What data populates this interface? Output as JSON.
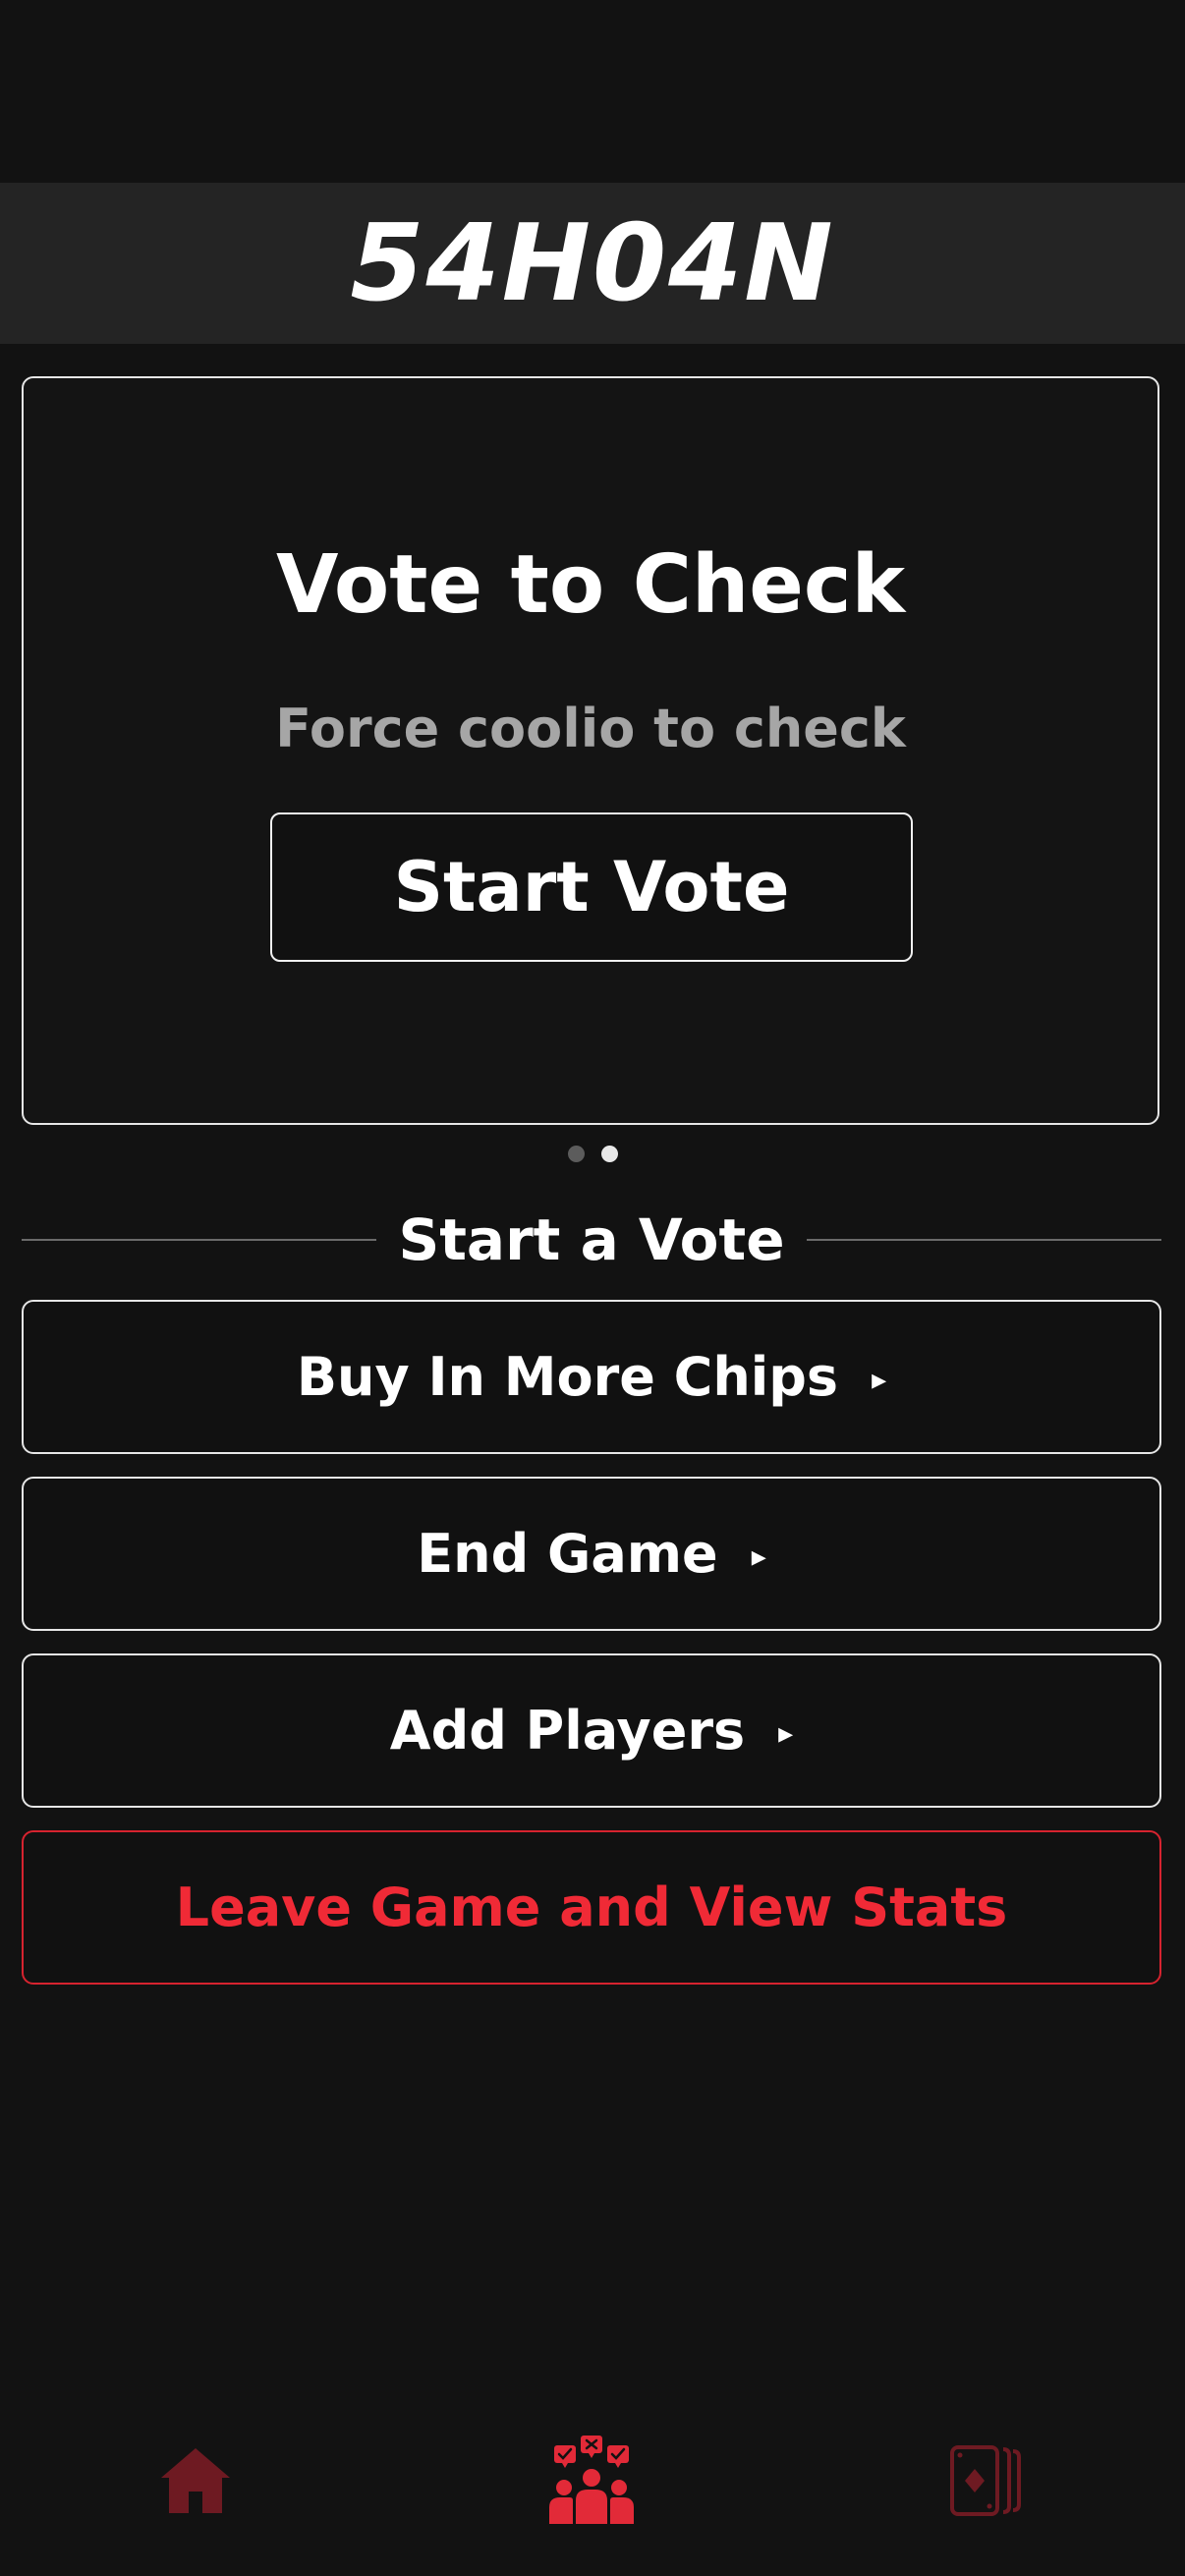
{
  "header": {
    "game_code": "54H04N"
  },
  "vote_card": {
    "title": "Vote to Check",
    "subtitle": "Force coolio to check",
    "button_label": "Start Vote"
  },
  "pager": {
    "total": 2,
    "active_index": 1
  },
  "section": {
    "title": "Start a Vote"
  },
  "actions": [
    {
      "label": "Buy In More Chips",
      "arrow": "▸"
    },
    {
      "label": "End Game",
      "arrow": "▸"
    },
    {
      "label": "Add Players",
      "arrow": "▸"
    }
  ],
  "leave_button": {
    "label": "Leave Game and View Stats"
  },
  "tab_bar": {
    "items": [
      {
        "icon": "home-icon",
        "active": false
      },
      {
        "icon": "group-vote-icon",
        "active": true
      },
      {
        "icon": "cards-icon",
        "active": false
      }
    ]
  },
  "colors": {
    "background": "#121212",
    "header_bar": "#242424",
    "accent_red": "#f02a36",
    "tab_active": "#e22a38",
    "tab_inactive": "#6e1a22",
    "subtitle_gray": "#a6a6a6"
  }
}
